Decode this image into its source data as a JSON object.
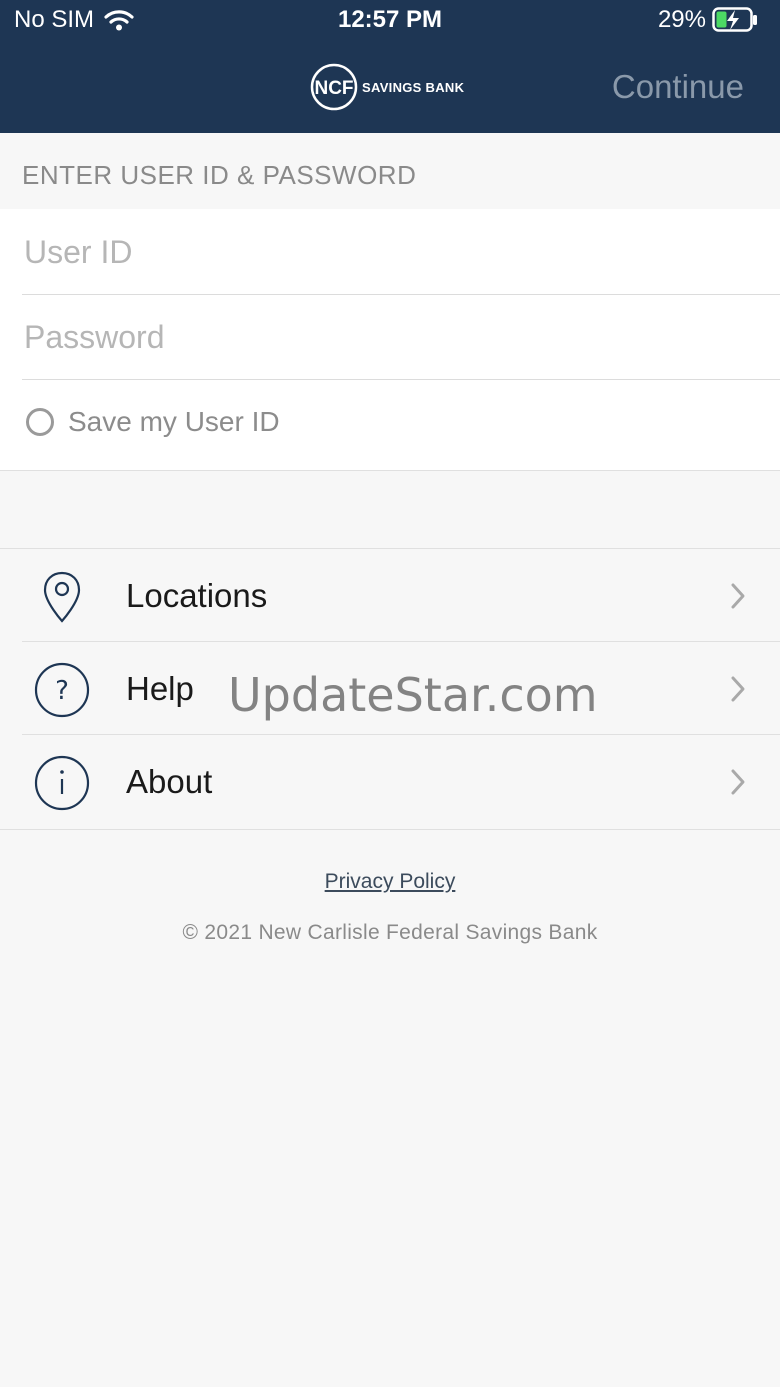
{
  "status_bar": {
    "carrier": "No SIM",
    "time": "12:57 PM",
    "battery": "29%",
    "wifi_icon": "wifi-icon",
    "battery_icon": "battery-charging-icon"
  },
  "header": {
    "logo_monogram": "NCF",
    "logo_text": "SAVINGS BANK",
    "continue_label": "Continue",
    "background": "#1e3654",
    "continue_color": "#8a99aa"
  },
  "login": {
    "heading": "ENTER USER ID & PASSWORD",
    "user_id_placeholder": "User ID",
    "user_id_value": "",
    "password_placeholder": "Password",
    "password_value": "",
    "save_label": "Save my User ID",
    "save_checked": false
  },
  "menu": {
    "items": [
      {
        "label": "Locations",
        "icon": "location-pin-icon"
      },
      {
        "label": "Help",
        "icon": "question-circle-icon"
      },
      {
        "label": "About",
        "icon": "info-circle-icon"
      }
    ]
  },
  "watermark": "UpdateStar.com",
  "footer": {
    "privacy_label": "Privacy Policy",
    "copyright": "© 2021 New Carlisle Federal Savings Bank"
  }
}
